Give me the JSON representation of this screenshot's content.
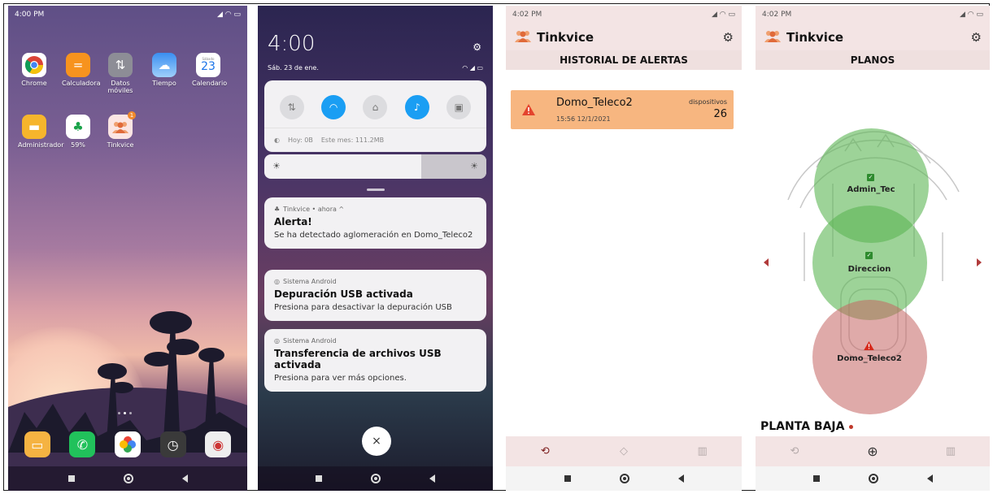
{
  "home": {
    "status_time": "4:00 PM",
    "status_icons": "⏰ ✉ …",
    "apps": [
      {
        "label": "Chrome",
        "icon": "chrome-icon"
      },
      {
        "label": "Calculadora",
        "icon": "calculator-icon"
      },
      {
        "label": "Datos móviles",
        "icon": "mobile-data-icon"
      },
      {
        "label": "Tiempo",
        "icon": "weather-icon"
      },
      {
        "label": "Calendario",
        "icon": "calendar-icon",
        "day": "23",
        "weekday": "Sábado"
      },
      {
        "label": "Administrador",
        "icon": "folder-icon"
      },
      {
        "label": "59%",
        "icon": "cleaner-icon"
      },
      {
        "label": "Tinkvice",
        "icon": "tinkvice-icon",
        "badge": "1"
      }
    ]
  },
  "shade": {
    "time": "4:00",
    "date": "Sáb. 23 de ene.",
    "usage_today": "Hoy: 0B",
    "usage_month": "Este mes: 111.2MB",
    "notifications": [
      {
        "source": "Tinkvice • ahora ^",
        "title": "Alerta!",
        "body": "Se ha detectado aglomeración en Domo_Teleco2"
      },
      {
        "source": "Sistema Android",
        "title": "Depuración USB activada",
        "body": "Presiona para desactivar la depuración USB"
      },
      {
        "source": "Sistema Android",
        "title": "Transferencia de archivos USB activada",
        "body": "Presiona para ver más opciones."
      }
    ],
    "close_label": "×"
  },
  "app": {
    "status_time": "4:02 PM",
    "name": "Tinkvice",
    "alerts_title": "HISTORIAL DE ALERTAS",
    "alert": {
      "name": "Domo_Teleco2",
      "time": "15:56 12/1/2021",
      "devices_label": "dispositivos",
      "devices": "26"
    },
    "plans_title": "PLANOS",
    "zones": [
      {
        "name": "Admin_Tec",
        "status": "ok"
      },
      {
        "name": "Direccion",
        "status": "ok"
      },
      {
        "name": "Domo_Teleco2",
        "status": "alert"
      }
    ],
    "floor": "PLANTA BAJA"
  },
  "colors": {
    "accent": "#1a9ef3",
    "app_bar": "#f3e4e4",
    "alert": "#f7b680",
    "ok_zone": "#7cc674",
    "alert_zone": "#d9928f"
  }
}
